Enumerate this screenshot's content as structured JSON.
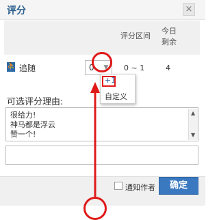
{
  "dialog": {
    "title": "评分",
    "close_glyph": "×"
  },
  "table": {
    "headers": {
      "range": "评分区间",
      "remaining": "今日剩余"
    },
    "row": {
      "name": "追随",
      "score_value": "0",
      "range": "0 ~ 1",
      "remaining": "4"
    }
  },
  "dropdown": {
    "options": [
      "+1",
      "自定义"
    ]
  },
  "reason": {
    "label": "可选评分理由:",
    "options": [
      "很给力!",
      "神马都是浮云",
      "赞一个!"
    ],
    "input_value": ""
  },
  "footer": {
    "notify_label": "通知作者",
    "confirm_label": "确定"
  },
  "colors": {
    "title": "#2c5f8d",
    "confirm": "#3a79c0",
    "annotation": "#e01818"
  }
}
